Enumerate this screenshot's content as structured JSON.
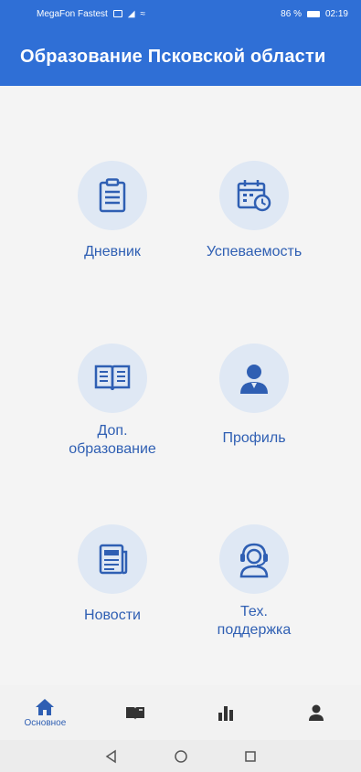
{
  "status_bar": {
    "carrier": "MegaFon Fastest",
    "battery": "86 %",
    "time": "02:19"
  },
  "app_bar": {
    "title": "Образование Псковской области"
  },
  "tiles": [
    {
      "label": "Дневник",
      "icon": "clipboard-icon"
    },
    {
      "label": "Успеваемость",
      "icon": "calendar-clock-icon"
    },
    {
      "label": "Доп.\nобразование",
      "icon": "open-book-icon"
    },
    {
      "label": "Профиль",
      "icon": "user-icon"
    },
    {
      "label": "Новости",
      "icon": "newspaper-icon"
    },
    {
      "label": "Тех.\nподдержка",
      "icon": "support-headset-icon"
    }
  ],
  "bottom_nav": {
    "items": [
      {
        "label": "Основное",
        "icon": "home-icon",
        "active": true
      },
      {
        "label": "",
        "icon": "book-icon",
        "active": false
      },
      {
        "label": "",
        "icon": "bar-chart-icon",
        "active": false
      },
      {
        "label": "",
        "icon": "user-icon",
        "active": false
      }
    ]
  },
  "colors": {
    "primary": "#2f6fd6",
    "icon_blue": "#2f5fb3",
    "circle_bg": "#dfe8f4",
    "background": "#f4f4f4"
  }
}
